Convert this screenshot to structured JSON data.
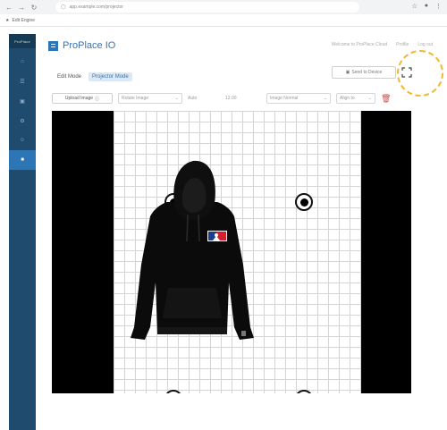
{
  "browser": {
    "url": "app.example.com/projector",
    "bookmark": "Edit Engine",
    "icons": [
      "back-icon",
      "forward-icon",
      "reload-icon",
      "lock-icon",
      "star-icon",
      "profile-icon",
      "kebab-menu-icon"
    ]
  },
  "sidebar": {
    "logo": "ProPlace",
    "items": [
      {
        "icon": "home-icon",
        "active": false
      },
      {
        "icon": "layers-icon",
        "active": false
      },
      {
        "icon": "image-icon",
        "active": false
      },
      {
        "icon": "settings-icon",
        "active": false
      },
      {
        "icon": "user-icon",
        "active": false
      },
      {
        "icon": "projector-icon",
        "active": true
      }
    ]
  },
  "header": {
    "app_name": "ProPlace IO",
    "links": [
      "Welcome to ProPlace Cloud",
      "Profile",
      "Log out"
    ]
  },
  "modes": [
    {
      "label": "Edit Mode",
      "active": false
    },
    {
      "label": "Projector Mode",
      "active": true
    }
  ],
  "actions": {
    "send_label": "Send to Device",
    "fullscreen_icon": "fullscreen-icon"
  },
  "toolbar": {
    "upload_label": "Upload Image",
    "rotate_placeholder": "Rotate Image",
    "scale_value": "Auto",
    "offset_value": "12.00",
    "flip_placeholder": "Image Normal",
    "align_placeholder": "Align to"
  },
  "colors": {
    "sidebar": "#1f4c6e",
    "accent": "#2d76b5",
    "highlight": "#f2b632",
    "delete": "#d94545"
  }
}
